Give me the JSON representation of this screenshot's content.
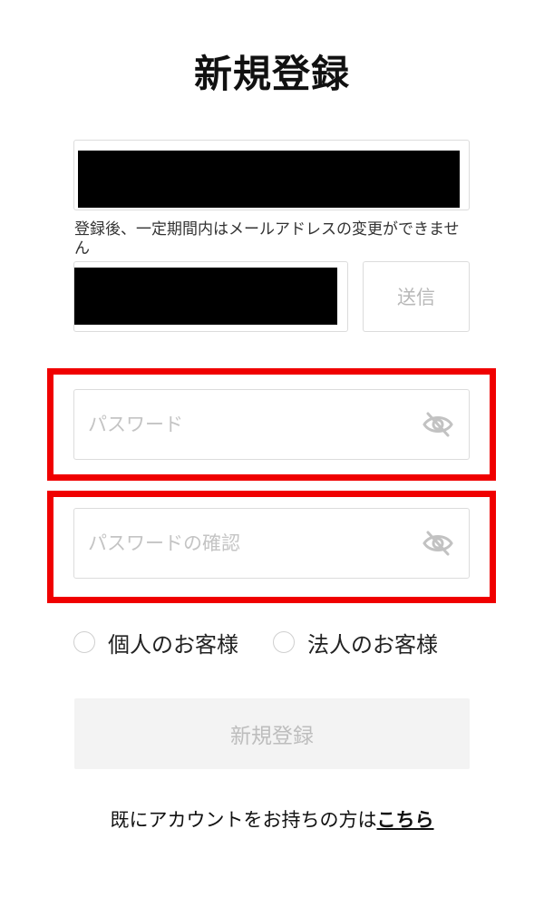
{
  "page": {
    "title": "新規登録"
  },
  "email": {
    "note": "登録後、一定期間内はメールアドレスの変更ができません"
  },
  "verification": {
    "send_label": "送信"
  },
  "password": {
    "placeholder": "パスワード",
    "toggle_icon": "eye-off-icon"
  },
  "password_confirm": {
    "placeholder": "パスワードの確認",
    "toggle_icon": "eye-off-icon"
  },
  "account_type": {
    "options": [
      {
        "label": "個人のお客様",
        "selected": false
      },
      {
        "label": "法人のお客様",
        "selected": false
      }
    ]
  },
  "submit": {
    "label": "新規登録"
  },
  "footer": {
    "text": "既にアカウントをお持ちの方は",
    "link_label": "こちら"
  },
  "colors": {
    "highlight": "#f00000",
    "border": "#dcdcdc",
    "disabled_text": "#bdbdbd",
    "disabled_bg": "#f3f3f3"
  }
}
